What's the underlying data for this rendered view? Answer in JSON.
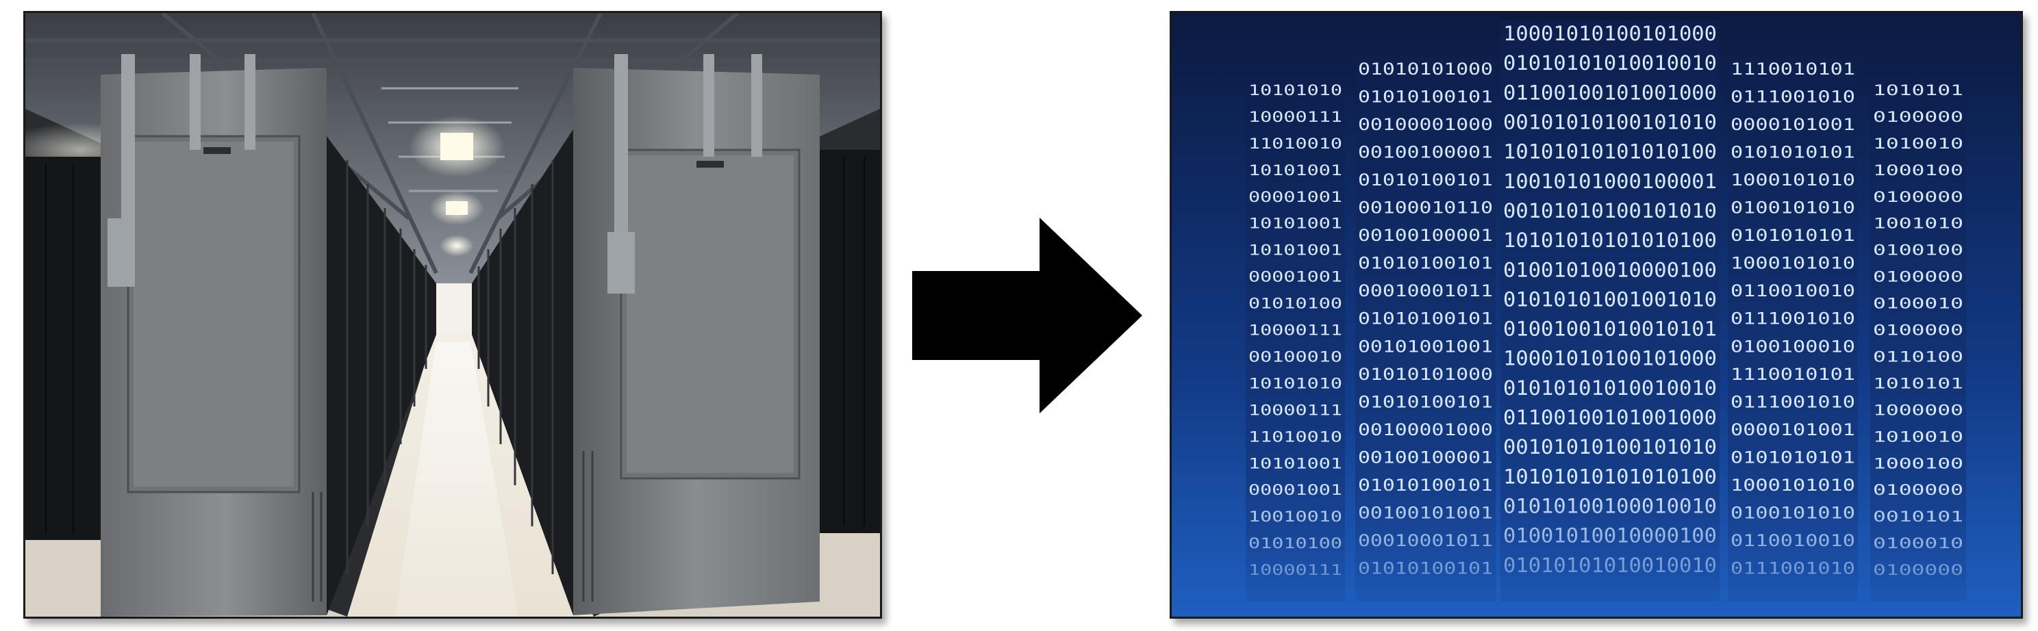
{
  "left_image": {
    "subject": "data-center-aisle-photo"
  },
  "arrow": {
    "icon": "right-arrow-icon",
    "color": "#000000"
  },
  "right_image": {
    "subject": "binary-code-columns-graphic",
    "background_colors": [
      "#0b1a40",
      "#123a86",
      "#1f5fc0"
    ],
    "digit_color": "#d8e8ff",
    "columns": [
      {
        "digits": [
          "10101010",
          "10000111",
          "11010010",
          "10101001",
          "00001001",
          "10101001",
          "10101001",
          "00001001",
          "01010100",
          "10000111",
          "00100010",
          "10101010",
          "10000111",
          "11010010",
          "10101001",
          "00001001",
          "10010010",
          "01010100",
          "10000111"
        ]
      },
      {
        "digits": [
          "01010101000",
          "01010100101",
          "00100001000",
          "00100100001",
          "01010100101",
          "00100010110",
          "00100100001",
          "01010100101",
          "00010001011",
          "01010100101",
          "00101001001",
          "01010101000",
          "01010100101",
          "00100001000",
          "00100100001",
          "01010100101",
          "00100101001",
          "00010001011",
          "01010100101"
        ]
      },
      {
        "digits": [
          "10001010100101000",
          "01010101010010010",
          "01100100101001000",
          "00101010100101010",
          "10101010101010100",
          "10010101000100001",
          "00101010100101010",
          "10101010101010100",
          "01001010010000100",
          "01010101001001010",
          "01001001010010101",
          "10001010100101000",
          "01010101010010010",
          "01100100101001000",
          "00101010100101010",
          "10101010101010100",
          "01010100100010010",
          "01001010010000100",
          "01010101010010010"
        ]
      },
      {
        "digits": [
          "1110010101",
          "0111001010",
          "0000101001",
          "0101010101",
          "1000101010",
          "0100101010",
          "0101010101",
          "1000101010",
          "0110010010",
          "0111001010",
          "0100100010",
          "1110010101",
          "0111001010",
          "0000101001",
          "0101010101",
          "1000101010",
          "0100101010",
          "0110010010",
          "0111001010"
        ]
      },
      {
        "digits": [
          "1010101",
          "0100000",
          "1010010",
          "1000100",
          "0100000",
          "1001010",
          "0100100",
          "0100000",
          "0100010",
          "0100000",
          "0110100",
          "1010101",
          "1000000",
          "1010010",
          "1000100",
          "0100000",
          "0010101",
          "0100010",
          "0100000"
        ]
      }
    ]
  }
}
